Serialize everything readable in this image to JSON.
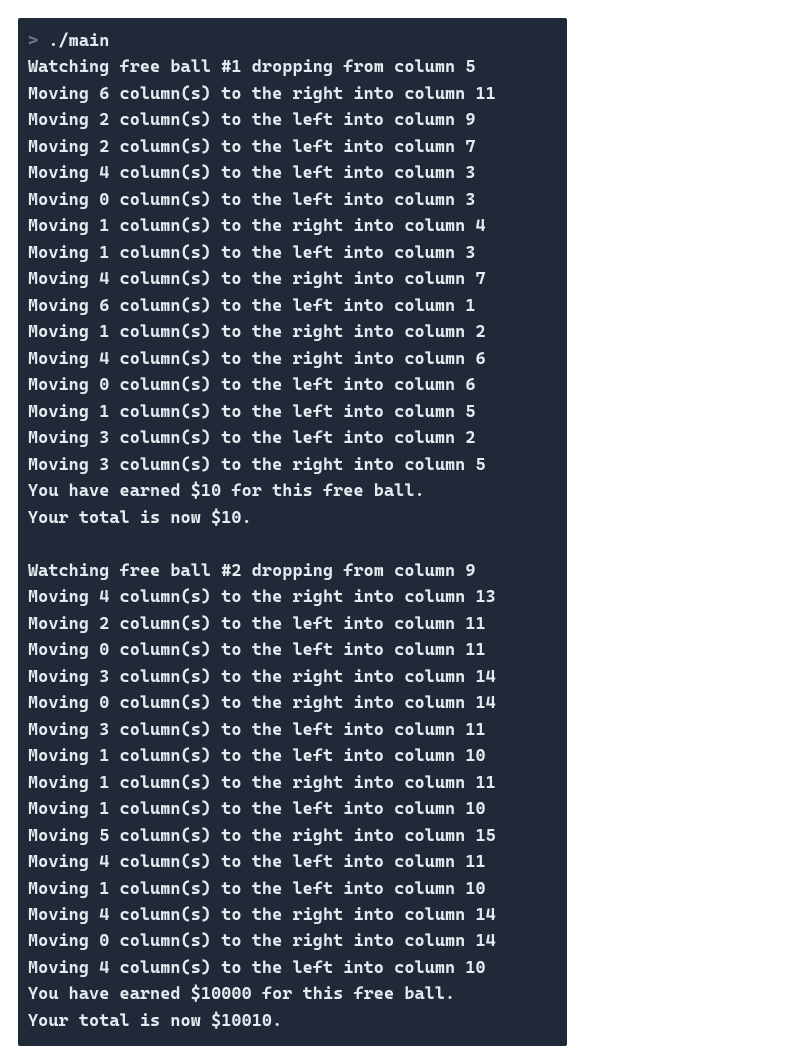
{
  "prompt": {
    "symbol": ">",
    "command": "./main"
  },
  "lines": [
    "Watching free ball #1 dropping from column 5",
    "Moving 6 column(s) to the right into column 11",
    "Moving 2 column(s) to the left into column 9",
    "Moving 2 column(s) to the left into column 7",
    "Moving 4 column(s) to the left into column 3",
    "Moving 0 column(s) to the left into column 3",
    "Moving 1 column(s) to the right into column 4",
    "Moving 1 column(s) to the left into column 3",
    "Moving 4 column(s) to the right into column 7",
    "Moving 6 column(s) to the left into column 1",
    "Moving 1 column(s) to the right into column 2",
    "Moving 4 column(s) to the right into column 6",
    "Moving 0 column(s) to the left into column 6",
    "Moving 1 column(s) to the left into column 5",
    "Moving 3 column(s) to the left into column 2",
    "Moving 3 column(s) to the right into column 5",
    "You have earned $10 for this free ball.",
    "Your total is now $10.",
    "",
    "Watching free ball #2 dropping from column 9",
    "Moving 4 column(s) to the right into column 13",
    "Moving 2 column(s) to the left into column 11",
    "Moving 0 column(s) to the left into column 11",
    "Moving 3 column(s) to the right into column 14",
    "Moving 0 column(s) to the right into column 14",
    "Moving 3 column(s) to the left into column 11",
    "Moving 1 column(s) to the left into column 10",
    "Moving 1 column(s) to the right into column 11",
    "Moving 1 column(s) to the left into column 10",
    "Moving 5 column(s) to the right into column 15",
    "Moving 4 column(s) to the left into column 11",
    "Moving 1 column(s) to the left into column 10",
    "Moving 4 column(s) to the right into column 14",
    "Moving 0 column(s) to the right into column 14",
    "Moving 4 column(s) to the left into column 10",
    "You have earned $10000 for this free ball.",
    "Your total is now $10010."
  ]
}
